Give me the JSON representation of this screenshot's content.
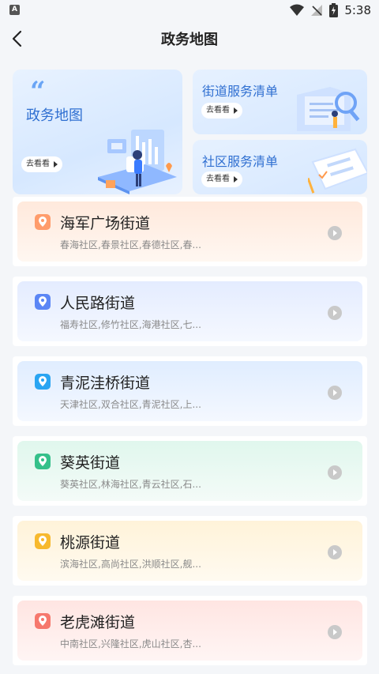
{
  "status_bar": {
    "time": "5:38",
    "left_icon": "A"
  },
  "nav": {
    "title": "政务地图",
    "back_icon": "chevron-left-icon"
  },
  "banners": {
    "main": {
      "title": "政务地图",
      "button": "去看看"
    },
    "street": {
      "title": "街道服务清单",
      "button": "去看看"
    },
    "community": {
      "title": "社区服务清单",
      "button": "去看看"
    }
  },
  "streets": [
    {
      "name": "海军广场街道",
      "communities": "春海社区,春景社区,春德社区,春...",
      "color": "#ff9c6b"
    },
    {
      "name": "人民路街道",
      "communities": "福寿社区,修竹社区,海港社区,七...",
      "color": "#5b86f5"
    },
    {
      "name": "青泥洼桥街道",
      "communities": "天津社区,双合社区,青泥社区,上...",
      "color": "#2aa5f2"
    },
    {
      "name": "葵英街道",
      "communities": "葵英社区,林海社区,青云社区,石...",
      "color": "#35c08a"
    },
    {
      "name": "桃源街道",
      "communities": "滨海社区,高尚社区,洪顺社区,舰...",
      "color": "#f7b92e"
    },
    {
      "name": "老虎滩街道",
      "communities": "中南社区,兴隆社区,虎山社区,杏...",
      "color": "#f6786d"
    }
  ]
}
